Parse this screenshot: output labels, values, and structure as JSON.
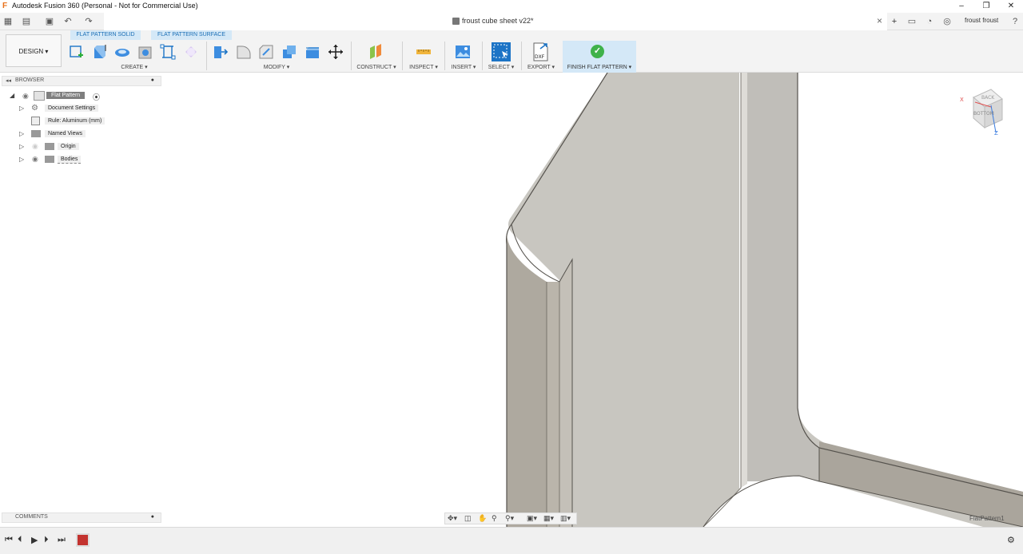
{
  "window": {
    "title": "Autodesk Fusion 360 (Personal - Not for Commercial Use)",
    "logo": "F",
    "controls": [
      "–",
      "❐",
      "✕"
    ]
  },
  "document": {
    "name": "froust cube sheet v22*",
    "user": "froust froust"
  },
  "workspace": {
    "label": "DESIGN ▾"
  },
  "ribbon": {
    "tabs": [
      "FLAT PATTERN SOLID",
      "FLAT PATTERN SURFACE"
    ],
    "groups": {
      "create": "CREATE ▾",
      "modify": "MODIFY ▾",
      "construct": "CONSTRUCT ▾",
      "inspect": "INSPECT ▾",
      "insert": "INSERT ▾",
      "select": "SELECT ▾",
      "export": "EXPORT ▾",
      "finish": "FINISH FLAT PATTERN ▾"
    },
    "export_icon_text": "DXF"
  },
  "browser": {
    "title": "BROWSER",
    "items": [
      {
        "label": "Flat Pattern"
      },
      {
        "label": "Document Settings"
      },
      {
        "label": "Rule: Aluminum (mm)"
      },
      {
        "label": "Named Views"
      },
      {
        "label": "Origin"
      },
      {
        "label": "Bodies"
      }
    ]
  },
  "comments": {
    "title": "COMMENTS"
  },
  "viewport": {
    "component_label": "FlatPattern1",
    "viewcube": {
      "face_back": "BACK",
      "face_bottom": "BOTTOM",
      "axis_x": "X",
      "axis_z": "Z"
    }
  },
  "colors": {
    "accent": "#1c6fb6",
    "tab_bg": "#d4e8f7",
    "finish_green": "#3fb24a",
    "model_face": "#c7c5be",
    "model_dark": "#a9a49a"
  }
}
